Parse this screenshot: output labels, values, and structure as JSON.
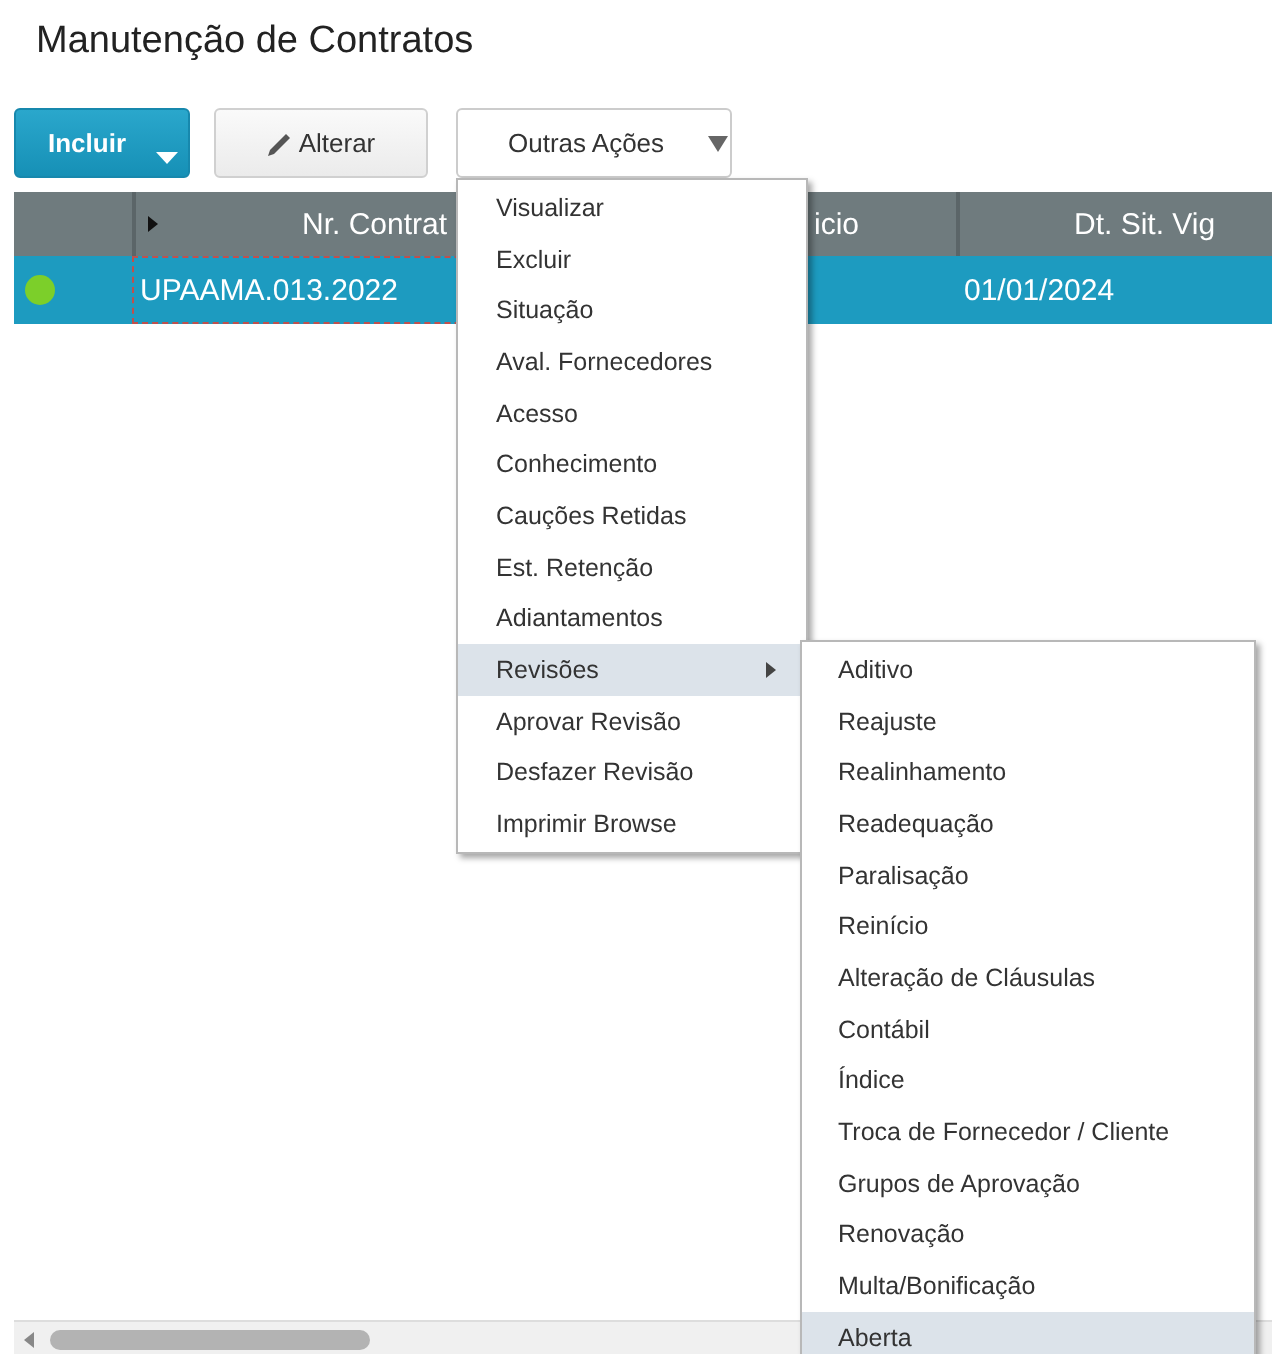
{
  "page_title": "Manutenção de Contratos",
  "toolbar": [
    {
      "kind": "primary",
      "label": "Incluir"
    },
    {
      "kind": "edit",
      "label": "Alterar"
    },
    {
      "kind": "dropdown",
      "label": "Outras Ações"
    }
  ],
  "table": {
    "columns": [
      "",
      "Nr. Contrat",
      "icio",
      "Dt. Sit. Vig"
    ],
    "rows": [
      {
        "selected": true,
        "color": "#7ccf2a",
        "cells": [
          "UPAAMA.013.2022",
          "",
          "01/01/2024"
        ]
      }
    ]
  },
  "menu": {
    "items": [
      {
        "label": "Visualizar",
        "selected": false,
        "has_submenu": false
      },
      {
        "label": "Excluir",
        "selected": false,
        "has_submenu": false
      },
      {
        "label": "Situação",
        "selected": false,
        "has_submenu": false
      },
      {
        "label": "Aval. Fornecedores",
        "selected": false,
        "has_submenu": false
      },
      {
        "label": "Acesso",
        "selected": false,
        "has_submenu": false
      },
      {
        "label": "Conhecimento",
        "selected": false,
        "has_submenu": false
      },
      {
        "label": "Cauções Retidas",
        "selected": false,
        "has_submenu": false
      },
      {
        "label": "Est. Retenção",
        "selected": false,
        "has_submenu": false
      },
      {
        "label": "Adiantamentos",
        "selected": false,
        "has_submenu": false
      },
      {
        "label": "Revisões",
        "selected": true,
        "has_submenu": true
      },
      {
        "label": "Aprovar Revisão",
        "selected": false,
        "has_submenu": false
      },
      {
        "label": "Desfazer Revisão",
        "selected": false,
        "has_submenu": false
      },
      {
        "label": "Imprimir Browse",
        "selected": false,
        "has_submenu": false
      }
    ]
  },
  "submenu": {
    "items": [
      {
        "label": "Aditivo",
        "selected": false
      },
      {
        "label": "Reajuste",
        "selected": false
      },
      {
        "label": "Realinhamento",
        "selected": false
      },
      {
        "label": "Readequação",
        "selected": false
      },
      {
        "label": "Paralisação",
        "selected": false
      },
      {
        "label": "Reinício",
        "selected": false
      },
      {
        "label": "Alteração de Cláusulas",
        "selected": false
      },
      {
        "label": "Contábil",
        "selected": false
      },
      {
        "label": "Índice",
        "selected": false
      },
      {
        "label": "Troca de Fornecedor / Cliente",
        "selected": false
      },
      {
        "label": "Grupos de Aprovação",
        "selected": false
      },
      {
        "label": "Renovação",
        "selected": false
      },
      {
        "label": "Multa/Bonificação",
        "selected": false
      },
      {
        "label": "Aberta",
        "selected": true
      }
    ]
  }
}
